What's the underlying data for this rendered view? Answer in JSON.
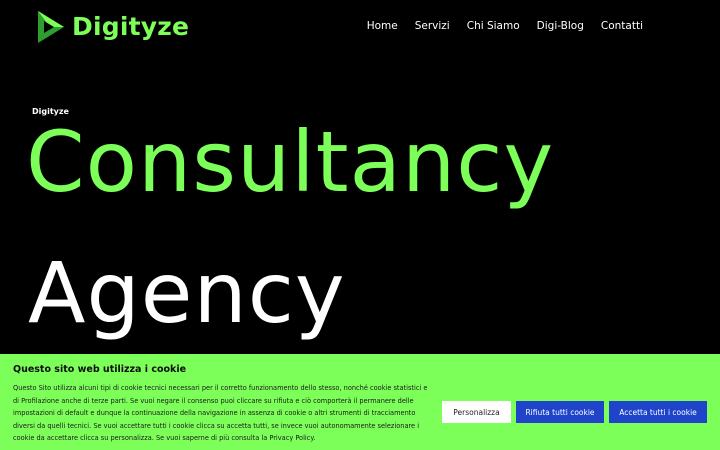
{
  "header": {
    "logo_text": "Digityze",
    "nav": [
      "Home",
      "Servizi",
      "Chi Siamo",
      "Digi-Blog",
      "Contatti"
    ]
  },
  "hero": {
    "eyebrow": "Digityze",
    "line1": "Consultancy",
    "line2": "Agency"
  },
  "cookie_banner": {
    "title": "Questo sito web utilizza i cookie",
    "text": "Questo Sito utilizza alcuni tipi di cookie tecnici necessari per il corretto funzionamento dello stesso, nonché cookie statistici e di Profilazione anche di terze parti. Se vuoi negare il consenso puoi cliccare su rifiuta e ciò comporterà il permanere delle impostazioni di default e dunque la continuazione della navigazione in assenza di cookie o altri strumenti di tracciamento diversi da quelli tecnici. Se vuoi accettare tutti i cookie clicca su accetta tutti, se invece vuoi autonomamente selezionare i cookie da accettare clicca su personalizza. Se vuoi saperne di più consulta la Privacy Policy.",
    "buttons": {
      "customize": "Personalizza",
      "reject": "Rifiuta tutti cookie",
      "accept": "Accetta tutti i cookie"
    }
  },
  "colors": {
    "accent": "#7dff5a",
    "button_blue": "#1f44c9",
    "background": "#000000"
  }
}
